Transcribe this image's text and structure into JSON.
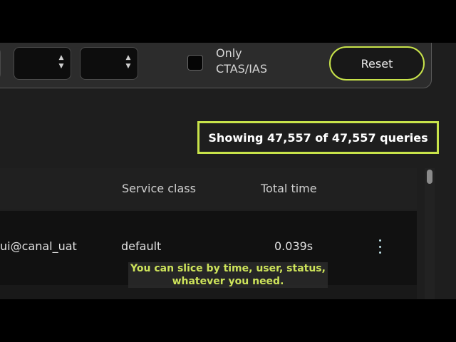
{
  "filters": {
    "only_label_line1": "Only",
    "only_label_line2": "CTAS/IAS",
    "reset_label": "Reset"
  },
  "status": {
    "text": "Showing 47,557 of 47,557 queries"
  },
  "table": {
    "columns": [
      "Service class",
      "Total time"
    ],
    "rows": [
      {
        "user": "ui@canal_uat",
        "service_class": "default",
        "total_time": "0.039s"
      }
    ]
  },
  "caption": {
    "line1": "You can slice by time, user, status,",
    "line2": "whatever you need."
  },
  "colors": {
    "accent": "#c8e34a",
    "background": "#1e1e1e"
  }
}
